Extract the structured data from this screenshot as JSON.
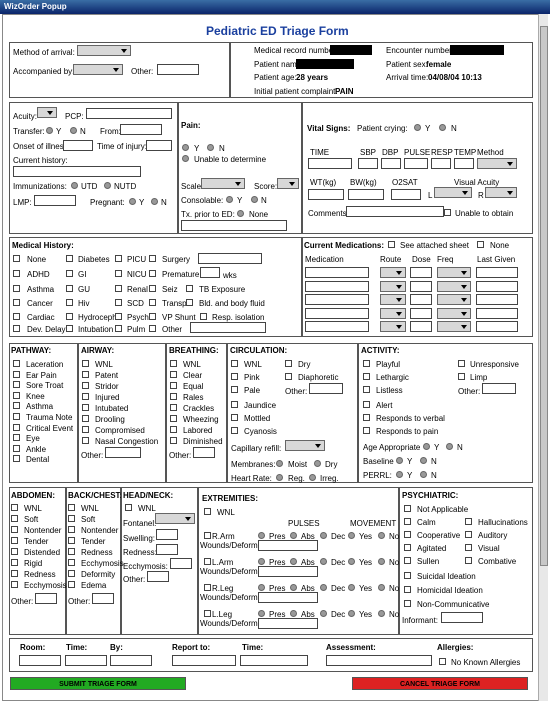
{
  "window": {
    "title": "WizOrder Popup"
  },
  "form": {
    "title": "Pediatric ED Triage Form"
  },
  "arrival": {
    "method_label": "Method of arrival:",
    "accompanied_label": "Accompanied by:",
    "other_label": "Other:"
  },
  "patient": {
    "mrn_label": "Medical record number",
    "encounter_label": "Encounter number",
    "name_label": "Patient name",
    "sex_label": "Patient sex:",
    "sex_value": "female",
    "age_label": "Patient age:",
    "age_value": "28 years",
    "arrival_label": "Arrival time:",
    "arrival_value": "04/08/04 10:13",
    "complaint_label": "Initial patient complaint:",
    "complaint_value": "PAIN"
  },
  "triage": {
    "acuity": "Acuity:",
    "pcp": "PCP:",
    "transfer": "Transfer:",
    "y": "Y",
    "n": "N",
    "from": "From:",
    "onset": "Onset of illness:",
    "time_injury": "Time of injury:",
    "current_history": "Current history:",
    "immunizations": "Immunizations:",
    "utd": "UTD",
    "nutd": "NUTD",
    "lmp": "LMP:",
    "pregnant": "Pregnant:"
  },
  "pain": {
    "label": "Pain:",
    "y": "Y",
    "n": "N",
    "unable": "Unable to determine",
    "scale": "Scale:",
    "score": "Score:",
    "consolable": "Consolable:",
    "tx_prior": "Tx. prior to ED:",
    "none": "None"
  },
  "vitals": {
    "label": "Vital Signs:",
    "crying": "Patient crying:",
    "y": "Y",
    "n": "N",
    "time": "TIME",
    "sbp": "SBP",
    "dbp": "DBP",
    "pulse": "PULSE",
    "resp": "RESP",
    "temp": "TEMP",
    "method": "Method",
    "wt": "WT(kg)",
    "bw": "BW(kg)",
    "o2sat": "O2SAT",
    "visual": "Visual Acuity",
    "l": "L",
    "r": "R",
    "comments": "Comments:",
    "unable": "Unable to obtain"
  },
  "history": {
    "label": "Medical History:",
    "items": [
      "None",
      "Diabetes",
      "PICU",
      "Surgery",
      "ADHD",
      "GI",
      "NICU",
      "Premature",
      "wks",
      "Asthma",
      "GU",
      "Renal",
      "Seiz",
      "TB Exposure",
      "Cancer",
      "Hiv",
      "SCD",
      "Transp.",
      "Bld. and body fluid",
      "Cardiac",
      "Hydroceph",
      "Psych",
      "VP Shunt",
      "Resp. isolation",
      "Dev. Delay",
      "Intubation",
      "Pulm",
      "Other"
    ]
  },
  "meds": {
    "label": "Current Medications:",
    "see_attached": "See attached sheet",
    "none": "None",
    "medication": "Medication",
    "route": "Route",
    "dose": "Dose",
    "freq": "Freq",
    "last_given": "Last Given"
  },
  "pathway": {
    "label": "PATHWAY:",
    "items": [
      "Laceration",
      "Ear Pain",
      "Sore Troat",
      "Knee",
      "Asthma",
      "Trauma Note",
      "Critical Event",
      "Eye",
      "Ankle",
      "Dental"
    ]
  },
  "airway": {
    "label": "AIRWAY:",
    "items": [
      "WNL",
      "Patent",
      "Stridor",
      "Injured",
      "Intubated",
      "Drooling",
      "Compromised",
      "Nasal Congestion"
    ],
    "other": "Other:"
  },
  "breathing": {
    "label": "BREATHING:",
    "items": [
      "WNL",
      "Clear",
      "Equal",
      "Rales",
      "Crackles",
      "Wheezing",
      "Labored",
      "Diminished"
    ],
    "other": "Other:"
  },
  "circulation": {
    "label": "CIRCULATION:",
    "wnl": "WNL",
    "dry": "Dry",
    "pink": "Pink",
    "diaphoretic": "Diaphoretic",
    "pale": "Pale",
    "other": "Other:",
    "jaundice": "Jaundice",
    "mottled": "Mottled",
    "cyanosis": "Cyanosis",
    "capillary": "Capillary refill:",
    "membranes": "Membranes:",
    "moist": "Moist",
    "dry2": "Dry",
    "heart_rate": "Heart Rate:",
    "reg": "Reg.",
    "irreg": "Irreg."
  },
  "activity": {
    "label": "ACTIVITY:",
    "playful": "Playful",
    "unresponsive": "Unresponsive",
    "lethargic": "Lethargic",
    "limp": "Limp",
    "listless": "Listless",
    "other": "Other:",
    "alert": "Alert",
    "verbal": "Responds to verbal",
    "pain": "Responds to pain",
    "age_appropriate": "Age Appropriate",
    "baseline": "Baseline",
    "perrl": "PERRL:",
    "y": "Y",
    "n": "N"
  },
  "abdomen": {
    "label": "ABDOMEN:",
    "items": [
      "WNL",
      "Soft",
      "Nontender",
      "Tender",
      "Distended",
      "Rigid",
      "Redness",
      "Ecchymosis"
    ],
    "other": "Other:"
  },
  "back": {
    "label": "BACK/CHEST:",
    "items": [
      "WNL",
      "Soft",
      "Nontender",
      "Tender",
      "Redness",
      "Ecchymosis",
      "Deformity",
      "Edema"
    ],
    "other": "Other:"
  },
  "head": {
    "label": "HEAD/NECK:",
    "wnl": "WNL",
    "fontanel": "Fontanel:",
    "swelling": "Swelling:",
    "redness": "Redness:",
    "ecchymosis": "Ecchymosis:",
    "other": "Other:"
  },
  "extremities": {
    "label": "EXTREMITIES:",
    "wnl": "WNL",
    "pulses": "PULSES",
    "movement": "MOVEMENT",
    "limbs": [
      "R.Arm",
      "L.Arm",
      "R.Leg",
      "L.Leg"
    ],
    "wounds": "Wounds/Deform",
    "pres": "Pres",
    "abs": "Abs",
    "dec": "Dec",
    "yes": "Yes",
    "no": "No"
  },
  "psych": {
    "label": "PSYCHIATRIC:",
    "na": "Not Applicable",
    "calm": "Calm",
    "halluc": "Hallucinations",
    "coop": "Cooperative",
    "auditory": "Auditory",
    "agitated": "Agitated",
    "visual": "Visual",
    "sullen": "Sullen",
    "combative": "Combative",
    "suicidal": "Suicidal Ideation",
    "homicidal": "Homicidal Ideation",
    "noncomm": "Non-Communicative",
    "informant": "Informant:"
  },
  "footer": {
    "room": "Room:",
    "time": "Time:",
    "by": "By:",
    "report": "Report to:",
    "time2": "Time:",
    "assessment": "Assessment:",
    "allergies": "Allergies:",
    "nka": "No Known Allergies"
  },
  "buttons": {
    "submit": "SUBMIT TRIAGE FORM",
    "cancel": "CANCEL TRIAGE FORM",
    "submit_color": "#22aa22",
    "cancel_color": "#dd2222"
  }
}
